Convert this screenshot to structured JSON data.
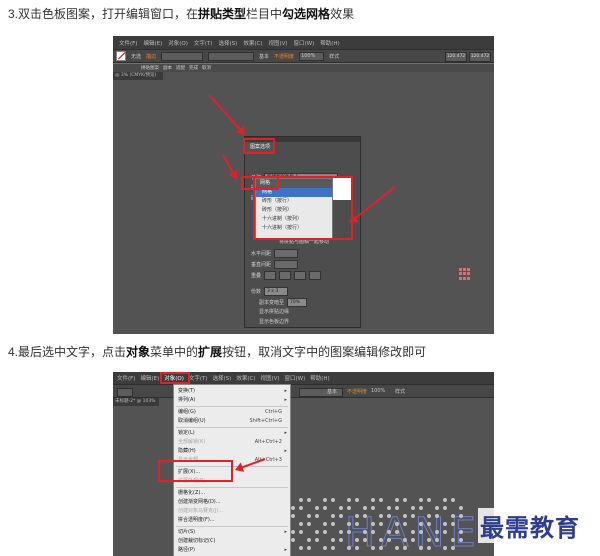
{
  "step3": {
    "caption_pre": "3.双击色板图案，打开编辑窗口，在",
    "caption_b1": "拼贴类型",
    "caption_mid": "栏目中",
    "caption_b2": "勾选网格",
    "caption_post": "效果"
  },
  "step4": {
    "caption_pre": "4.最后选中文字，点击",
    "caption_b1": "对象",
    "caption_mid": "菜单中的",
    "caption_b2": "扩展",
    "caption_post": "按钮，取消文字中的图案编辑修改即可"
  },
  "screenshot1": {
    "menu": [
      "文件(F)",
      "编辑(E)",
      "对象(O)",
      "文字(T)",
      "选择(S)",
      "效果(C)",
      "视图(V)",
      "窗口(W)",
      "帮助(H)"
    ],
    "control_bar": {
      "no_selection": "无选",
      "stroke_label": "描边",
      "style_label": "基本",
      "opacity_label": "不透明度",
      "opacity_value": "100%",
      "style2_label": "样式",
      "coord_w": "120.472",
      "coord_h": "120.472"
    },
    "bar2": {
      "done": "完成",
      "cancel": "取消",
      "items": [
        "拼贴图案",
        "副本",
        "适配"
      ]
    },
    "doc_tab": "@ 3% (CMYK/预览)",
    "panel": {
      "tab": "图案选项",
      "name_label": "名称",
      "name_value": "新建图案色板 1",
      "tile_type_label": "拼贴类型",
      "tile_type_value": "网格",
      "brick_offset_label": "砖形位移",
      "width_label": "宽度",
      "height_label": "高度",
      "size_to_art": "将拼贴调整为图稿大小",
      "move_with_art": "将拼贴与图稿一起移动",
      "h_spacing_label": "水平间距",
      "v_spacing_label": "垂直间距",
      "overlap_label": "重叠",
      "copies_label": "份数",
      "copies_value": "3 x 3",
      "dim_copies_label": "副本变暗至",
      "dim_copies_value": "70%",
      "show_tile_edge": "显示拼贴边缘",
      "show_swatch_bounds": "显示色板边界"
    },
    "dropdown": {
      "header": "网格",
      "items": [
        "网格",
        "砖形（按行）",
        "砖形（按列）",
        "十六进制（按列）",
        "十六进制（按行）"
      ]
    }
  },
  "screenshot2": {
    "menu": [
      "文件(F)",
      "编辑(E)",
      "对象(O)",
      "文字(T)",
      "选择(S)",
      "效果(C)",
      "视图(V)",
      "窗口(W)",
      "帮助(H)"
    ],
    "doc_tab": "未标题-2* @ 103%",
    "control_bar": {
      "opacity_label": "不透明度",
      "opacity_value": "100%",
      "style_label": "样式",
      "basic": "基本"
    },
    "object_menu": [
      {
        "label": "变换(T)",
        "shortcut": "",
        "arrow": "▸",
        "dim": false
      },
      {
        "label": "排列(A)",
        "shortcut": "",
        "arrow": "▸",
        "dim": false
      },
      {
        "label": "编组(G)",
        "shortcut": "Ctrl+G",
        "arrow": "",
        "dim": false
      },
      {
        "label": "取消编组(U)",
        "shortcut": "Shift+Ctrl+G",
        "arrow": "",
        "dim": false
      },
      {
        "label": "锁定(L)",
        "shortcut": "",
        "arrow": "▸",
        "dim": false
      },
      {
        "label": "全部解锁(K)",
        "shortcut": "Alt+Ctrl+2",
        "arrow": "",
        "dim": true
      },
      {
        "label": "隐藏(H)",
        "shortcut": "",
        "arrow": "▸",
        "dim": false
      },
      {
        "label": "显示全部",
        "shortcut": "Alt+Ctrl+3",
        "arrow": "",
        "dim": true
      },
      {
        "label": "扩展(X)...",
        "shortcut": "",
        "arrow": "",
        "dim": false
      },
      {
        "label": "扩展外观(E)",
        "shortcut": "",
        "arrow": "",
        "dim": true
      },
      {
        "label": "栅格化(Z)...",
        "shortcut": "",
        "arrow": "",
        "dim": false
      },
      {
        "label": "创建渐变网格(D)...",
        "shortcut": "",
        "arrow": "",
        "dim": false
      },
      {
        "label": "创建对象马赛克(J)...",
        "shortcut": "",
        "arrow": "",
        "dim": true
      },
      {
        "label": "拼合透明度(F)...",
        "shortcut": "",
        "arrow": "",
        "dim": false
      },
      {
        "label": "切片(S)",
        "shortcut": "",
        "arrow": "▸",
        "dim": false
      },
      {
        "label": "创建裁切标记(C)",
        "shortcut": "",
        "arrow": "",
        "dim": false
      },
      {
        "label": "路径(P)",
        "shortcut": "",
        "arrow": "▸",
        "dim": false
      }
    ]
  },
  "watermark": "最需教育",
  "colors": {
    "highlight": "#e0212a",
    "ui_dark": "#535353",
    "menu_bg": "#ececec",
    "selection": "#3d74c6"
  }
}
